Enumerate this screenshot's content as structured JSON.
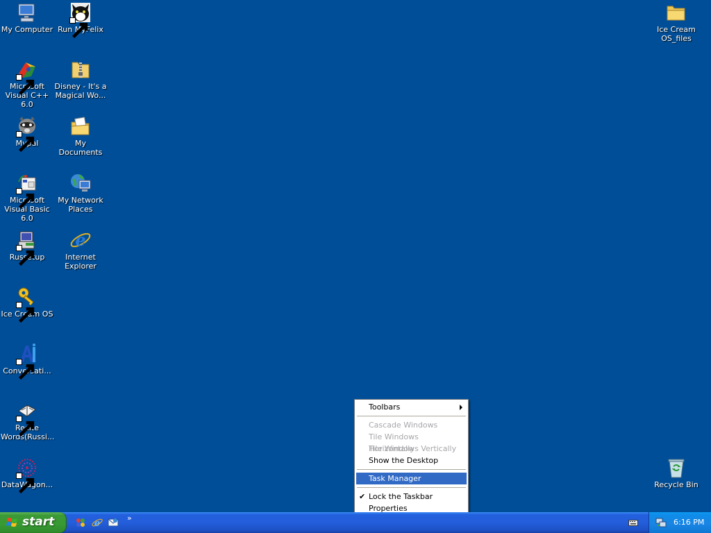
{
  "desktop_icons": {
    "my_computer": "My Computer",
    "run_myfelix": "Run MyFelix",
    "ice_cream_os_files": "Ice Cream OS_files",
    "msvc": "Microsoft Visual C++ 6.0",
    "disney": "Disney - It's a Magical Wo...",
    "mypal": "Mypal",
    "my_documents": "My Documents",
    "msvb": "Microsoft Visual Basic 6.0",
    "my_network_places": "My Network Places",
    "russetup": "Russetup",
    "internet_explorer": "Internet Explorer",
    "ice_cream_os": "Ice Cream OS",
    "conversati": "Conversati...",
    "recite_words": "Recite Words(Russi...",
    "datawagon": "DataWagon...",
    "recycle_bin": "Recycle Bin"
  },
  "context_menu": {
    "toolbars": "Toolbars",
    "cascade": "Cascade Windows",
    "tile_h": "Tile Windows Horizontally",
    "tile_v": "Tile Windows Vertically",
    "show_desktop": "Show the Desktop",
    "task_manager": "Task Manager",
    "lock_taskbar": "Lock the Taskbar",
    "lock_check": "✔",
    "properties": "Properties"
  },
  "taskbar": {
    "start_label": "start",
    "quicklaunch_more": "»",
    "clock": "6:16 PM"
  },
  "colors": {
    "desktop": "#004e98",
    "menu_highlight": "#316ac5",
    "start_green": "#3c9a36"
  }
}
